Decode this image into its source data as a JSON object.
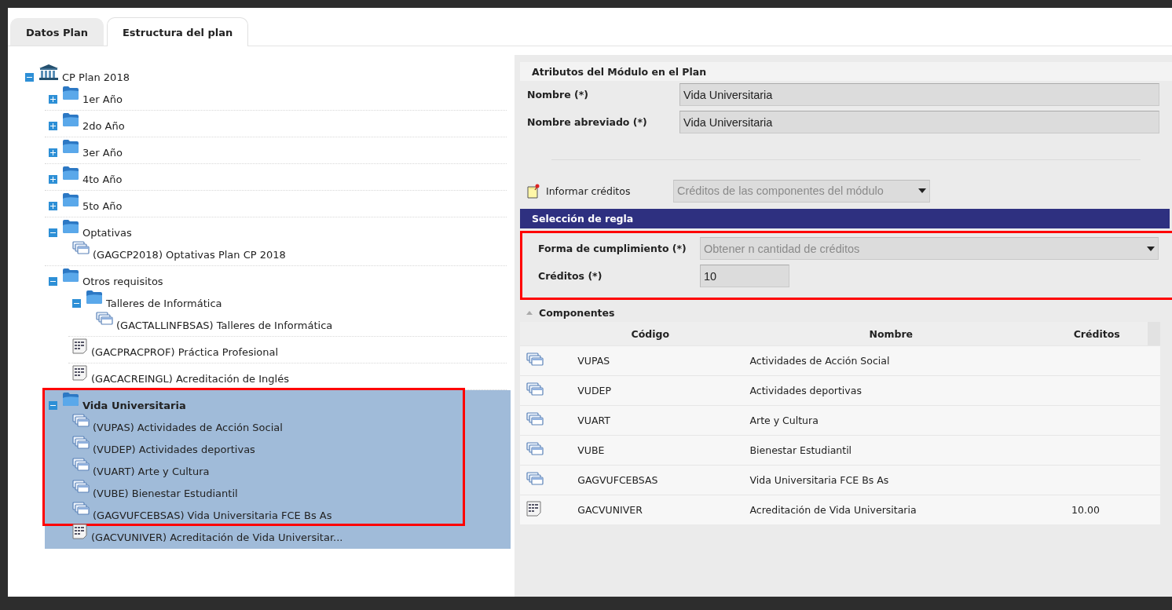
{
  "tabs": [
    {
      "label": "Datos Plan",
      "selected": false
    },
    {
      "label": "Estructura del plan",
      "selected": true
    }
  ],
  "tree": [
    {
      "label": "CP Plan 2018",
      "kind": "root",
      "expanded": true,
      "selected": false,
      "highlighted": false,
      "children": [
        {
          "label": "1er Año",
          "kind": "folder",
          "expanded": false,
          "selected": false,
          "highlighted": false
        },
        {
          "label": "2do Año",
          "kind": "folder",
          "expanded": false,
          "selected": false,
          "highlighted": false
        },
        {
          "label": "3er Año",
          "kind": "folder",
          "expanded": false,
          "selected": false,
          "highlighted": false
        },
        {
          "label": "4to Año",
          "kind": "folder",
          "expanded": false,
          "selected": false,
          "highlighted": false
        },
        {
          "label": "5to Año",
          "kind": "folder",
          "expanded": false,
          "selected": false,
          "highlighted": false
        },
        {
          "label": "Optativas",
          "kind": "folder",
          "expanded": true,
          "selected": false,
          "highlighted": false,
          "children": [
            {
              "label": "(GAGCP2018) Optativas Plan CP 2018",
              "kind": "module",
              "selected": false,
              "highlighted": false
            }
          ]
        },
        {
          "label": "Otros requisitos",
          "kind": "folder",
          "expanded": true,
          "selected": false,
          "highlighted": false,
          "children": [
            {
              "label": "Talleres de Informática",
              "kind": "folder",
              "expanded": true,
              "selected": false,
              "highlighted": false,
              "children": [
                {
                  "label": "(GACTALLINFBSAS) Talleres de Informática",
                  "kind": "module",
                  "selected": false,
                  "highlighted": false
                }
              ]
            },
            {
              "label": "(GACPRACPROF) Práctica Profesional",
              "kind": "activity",
              "selected": false,
              "highlighted": false
            },
            {
              "label": "(GACACREINGL) Acreditación de Inglés",
              "kind": "activity",
              "selected": false,
              "highlighted": false
            }
          ]
        },
        {
          "label": "Vida Universitaria",
          "kind": "folder",
          "expanded": true,
          "selected": true,
          "highlighted": true,
          "children": [
            {
              "label": "(VUPAS) Actividades de Acción Social",
              "kind": "module",
              "selected": false,
              "highlighted": true
            },
            {
              "label": "(VUDEP) Actividades deportivas",
              "kind": "module",
              "selected": false,
              "highlighted": true
            },
            {
              "label": "(VUART) Arte y Cultura",
              "kind": "module",
              "selected": false,
              "highlighted": true
            },
            {
              "label": "(VUBE) Bienestar Estudiantil",
              "kind": "module",
              "selected": false,
              "highlighted": true
            },
            {
              "label": "(GAGVUFCEBSAS) Vida Universitaria FCE Bs As",
              "kind": "module",
              "selected": false,
              "highlighted": true
            },
            {
              "label": "(GACVUNIVER) Acreditación de Vida Universitar...",
              "kind": "activity",
              "selected": false,
              "highlighted": false
            }
          ]
        }
      ]
    }
  ],
  "panel": {
    "title": "Atributos del Módulo en el Plan",
    "fields": [
      {
        "label": "Nombre (*)",
        "value": "Vida Universitaria",
        "kind": "text",
        "disabled": false
      },
      {
        "label": "Nombre abreviado (*)",
        "value": "Vida Universitaria",
        "kind": "text",
        "disabled": false
      }
    ],
    "credits_field": {
      "label": "Informar créditos",
      "value": "Créditos de las componentes del módulo",
      "kind": "select",
      "disabled": true
    },
    "rule_section": {
      "title": "Selección de regla",
      "highlighted": true,
      "fields": [
        {
          "label": "Forma de cumplimiento (*)",
          "value": "Obtener n cantidad de créditos",
          "kind": "select",
          "disabled": true
        },
        {
          "label": "Créditos (*)",
          "value": "10",
          "kind": "text",
          "disabled": false
        }
      ]
    },
    "components": {
      "title": "Componentes",
      "expanded": true,
      "columns": [
        "Código",
        "Nombre",
        "Créditos"
      ],
      "rows": [
        {
          "kind": "module",
          "code": "VUPAS",
          "name": "Actividades de Acción Social"
        },
        {
          "kind": "module",
          "code": "VUDEP",
          "name": "Actividades deportivas"
        },
        {
          "kind": "module",
          "code": "VUART",
          "name": "Arte y Cultura"
        },
        {
          "kind": "module",
          "code": "VUBE",
          "name": "Bienestar Estudiantil"
        },
        {
          "kind": "module",
          "code": "GAGVUFCEBSAS",
          "name": "Vida Universitaria FCE Bs As"
        },
        {
          "kind": "activity",
          "code": "GACVUNIVER",
          "name": "Acreditación de Vida Universitaria",
          "credits": "10.00"
        }
      ]
    }
  }
}
